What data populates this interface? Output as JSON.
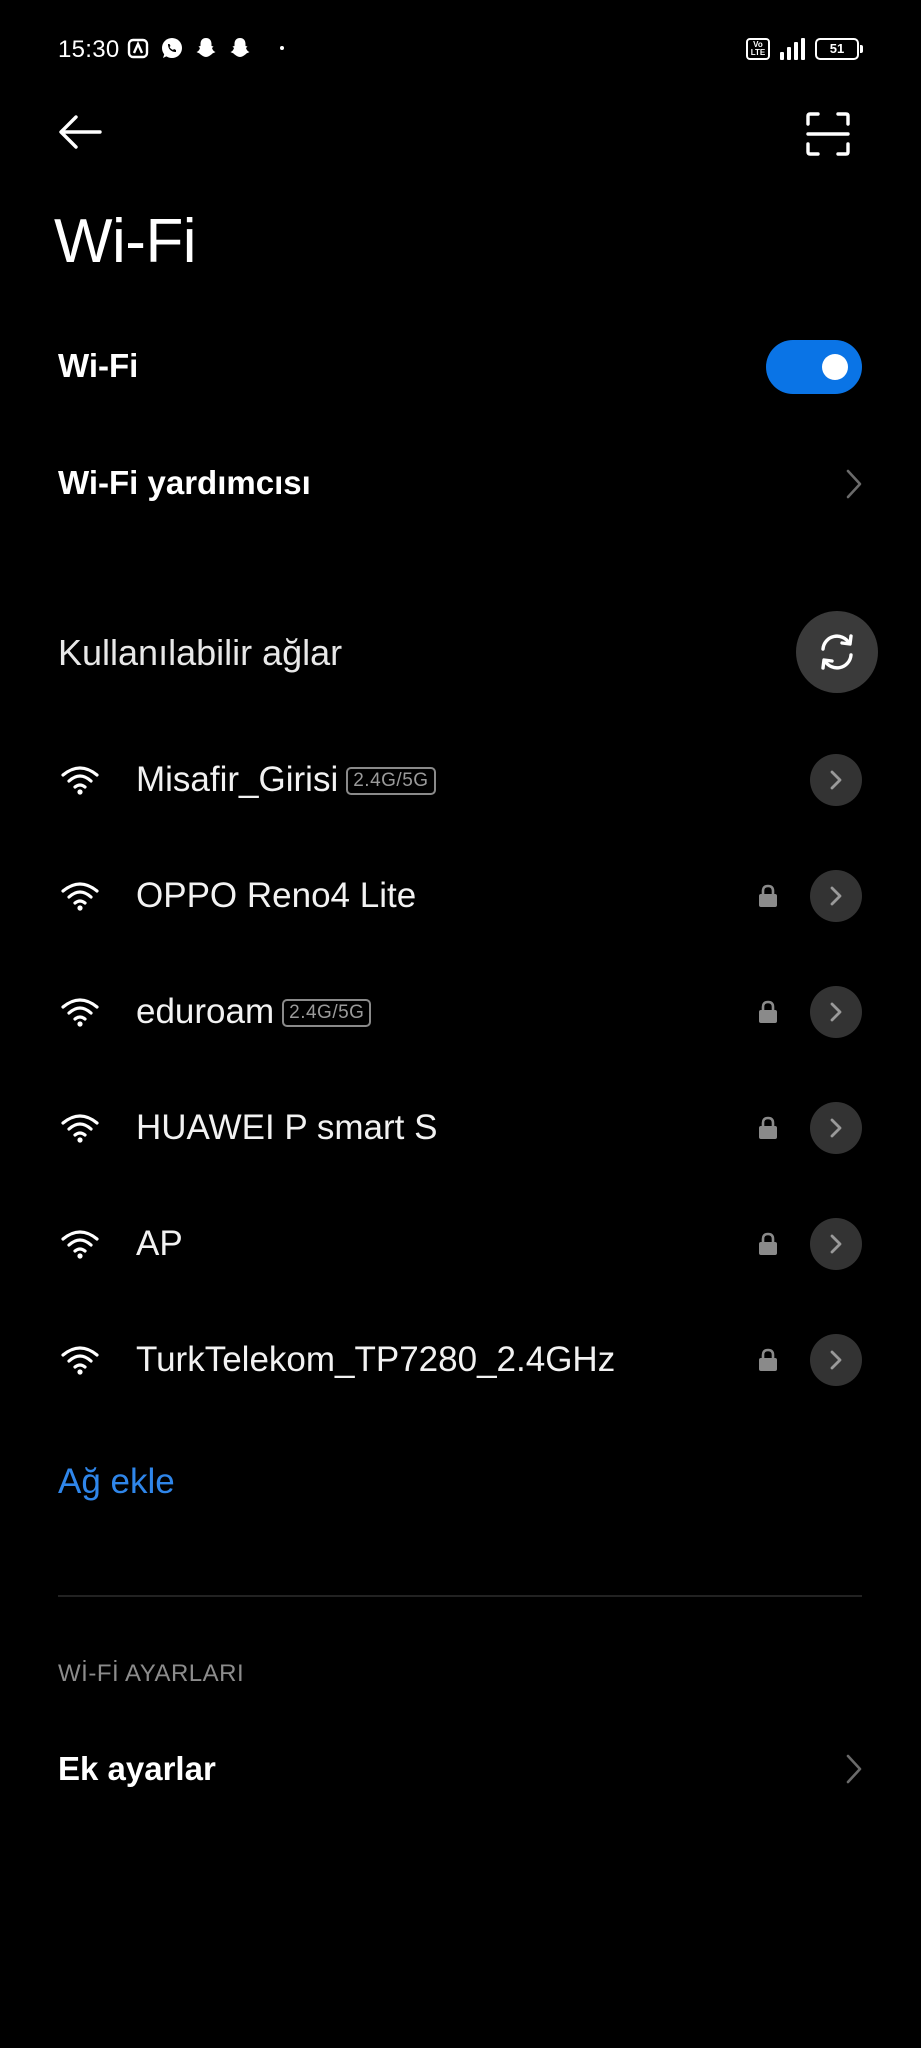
{
  "status_bar": {
    "time": "15:30",
    "left_icons": [
      "alarm-icon",
      "whatsapp-icon",
      "snapchat-icon",
      "snapchat-icon"
    ],
    "volte": "Vo LTE",
    "battery": "51"
  },
  "header": {
    "title": "Wi-Fi"
  },
  "wifi_toggle": {
    "label": "Wi-Fi",
    "enabled": true
  },
  "wifi_assistant": {
    "label": "Wi-Fi yardımcısı"
  },
  "available_networks": {
    "title": "Kullanılabilir ağlar",
    "networks": [
      {
        "name": "Misafir_Girisi",
        "band": "2.4G/5G",
        "secured": false
      },
      {
        "name": "OPPO Reno4 Lite",
        "band": "",
        "secured": true
      },
      {
        "name": "eduroam",
        "band": "2.4G/5G",
        "secured": true
      },
      {
        "name": "HUAWEI P smart S",
        "band": "",
        "secured": true
      },
      {
        "name": "AP",
        "band": "",
        "secured": true
      },
      {
        "name": "TurkTelekom_TP7280_2.4GHz",
        "band": "",
        "secured": true
      }
    ]
  },
  "add_network": {
    "label": "Ağ ekle"
  },
  "wifi_settings": {
    "header": "Wİ-Fİ AYARLARI",
    "more_settings": "Ek ayarlar"
  },
  "colors": {
    "background": "#000000",
    "accent": "#0a74e6",
    "link": "#2f86ea",
    "muted": "#8c8c8c"
  }
}
